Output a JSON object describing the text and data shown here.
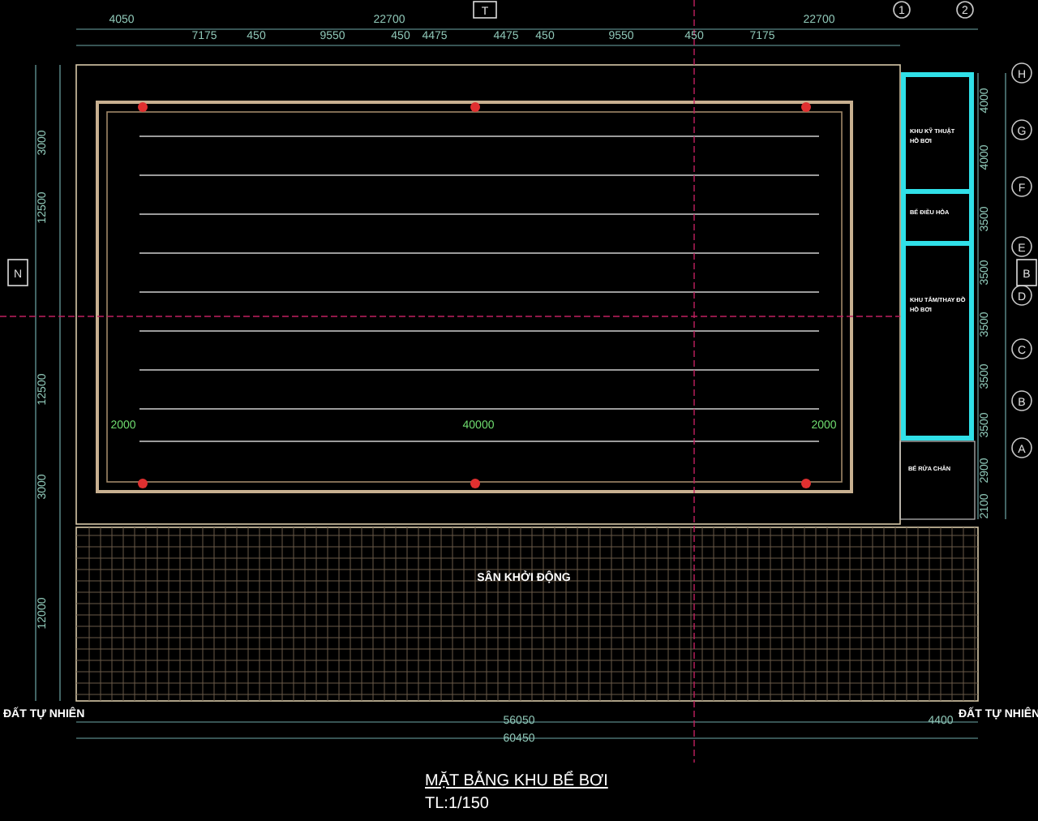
{
  "drawing": {
    "title": "MẶT BẰNG KHU BỂ BƠI",
    "scale": "TL:1/150",
    "top_dimensions": [
      "4050",
      "22700",
      "22700",
      "7175",
      "450",
      "9550",
      "450",
      "4475",
      "4475",
      "450",
      "9550",
      "450",
      "7175"
    ],
    "bottom_dimensions": [
      "56050",
      "4400",
      "60450"
    ],
    "left_dimensions": [
      "3000",
      "12500",
      "12500",
      "3000",
      "12000"
    ],
    "right_dimensions": [
      "4000",
      "4000",
      "3500",
      "3500",
      "3500",
      "3500",
      "3500",
      "2900",
      "2100"
    ],
    "pool_dimensions": [
      "2000",
      "40000",
      "2000"
    ],
    "right_axes": [
      "H",
      "G",
      "F",
      "E",
      "D",
      "C",
      "B",
      "A"
    ],
    "top_axes": [
      "1",
      "2"
    ],
    "section_marks": [
      "T",
      "N",
      "B"
    ],
    "rooms": [
      {
        "lines": [
          "KHU KỸ THUẬT",
          "HỒ BƠI"
        ]
      },
      {
        "lines": [
          "BỂ ĐIỀU HÒA"
        ]
      },
      {
        "lines": [
          "KHU TẮM/THAY ĐỒ",
          "HỒ BƠI"
        ]
      },
      {
        "lines": [
          "BỂ RỬA CHÂN"
        ]
      }
    ],
    "deck_label": "SÂN KHỞI ĐỘNG",
    "ground_labels": [
      "ĐẤT TỰ NHIÊN",
      "ĐẤT TỰ NHIÊN"
    ]
  }
}
